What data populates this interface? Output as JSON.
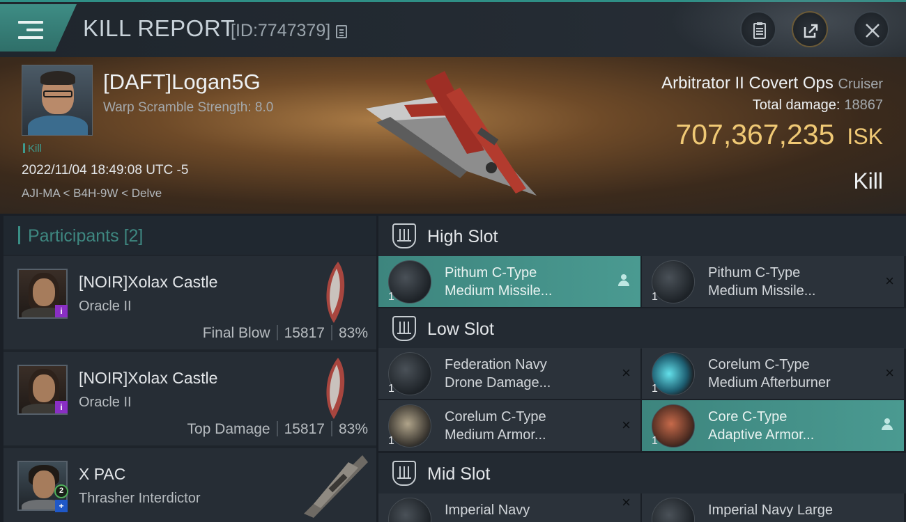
{
  "header": {
    "title": "KILL REPORT",
    "report_id": "[ID:7747379]"
  },
  "victim": {
    "name": "[DAFT]Logan5G",
    "subtitle": "Warp Scramble Strength: 8.0",
    "kill_tag": "Kill",
    "timestamp": "2022/11/04 18:49:08 UTC -5",
    "location": "AJI-MA < B4H-9W < Delve",
    "ship": "Arbitrator II Covert Ops",
    "ship_class": "Cruiser",
    "total_damage_label": "Total damage:",
    "total_damage": "18867",
    "isk_value": "707,367,235",
    "isk_unit": "ISK",
    "result": "Kill"
  },
  "participants": {
    "title": "Participants",
    "count": "[2]",
    "rows": [
      {
        "name": "[NOIR]Xolax Castle",
        "ship": "Oracle II",
        "role": "Final Blow",
        "damage": "15817",
        "percent": "83%"
      },
      {
        "name": "[NOIR]Xolax Castle",
        "ship": "Oracle II",
        "role": "Top Damage",
        "damage": "15817",
        "percent": "83%"
      },
      {
        "name": "X PAC",
        "ship": "Thrasher Interdictor",
        "badge_level": "2",
        "badge_plus": "+"
      }
    ]
  },
  "fitting": {
    "high": {
      "title": "High Slot",
      "modules": [
        {
          "line1": "Pithum C-Type",
          "line2": "Medium Missile...",
          "qty": "1",
          "status": "fitted-by-pilot"
        },
        {
          "line1": "Pithum C-Type",
          "line2": "Medium Missile...",
          "qty": "1",
          "status": "destroyed"
        }
      ]
    },
    "low": {
      "title": "Low Slot",
      "modules": [
        {
          "line1": "Federation Navy",
          "line2": "Drone Damage...",
          "qty": "1",
          "status": "destroyed"
        },
        {
          "line1": "Corelum C-Type",
          "line2": "Medium Afterburner",
          "qty": "1",
          "status": "destroyed"
        },
        {
          "line1": "Corelum C-Type",
          "line2": "Medium Armor...",
          "qty": "1",
          "status": "destroyed"
        },
        {
          "line1": "Core C-Type",
          "line2": "Adaptive Armor...",
          "qty": "1",
          "status": "fitted-by-pilot"
        }
      ]
    },
    "mid": {
      "title": "Mid Slot",
      "modules": [
        {
          "line1": "Imperial Navy",
          "status": "destroyed"
        },
        {
          "line1": "Imperial Navy Large"
        }
      ]
    }
  },
  "icons": {
    "destroyed": "×",
    "colors": {
      "accent": "#3e9a8e",
      "isk": "#f0c975",
      "active_row": "#4a9a91"
    }
  }
}
